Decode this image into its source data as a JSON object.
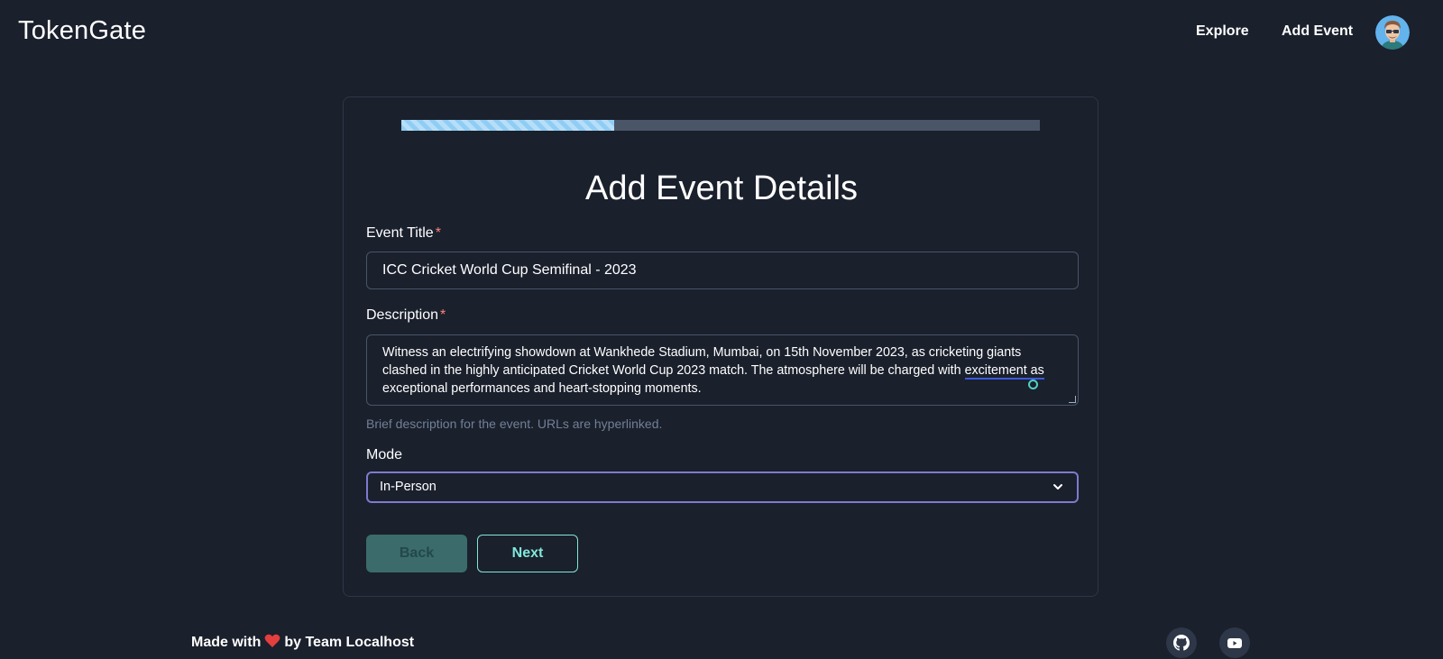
{
  "nav": {
    "brand": "TokenGate",
    "explore": "Explore",
    "add_event": "Add Event"
  },
  "form": {
    "progress_fraction": 0.333,
    "title": "Add Event Details",
    "event_title": {
      "label": "Event Title",
      "required_mark": "*",
      "value": "ICC Cricket World Cup Semifinal - 2023"
    },
    "description": {
      "label": "Description",
      "required_mark": "*",
      "value_before": "Witness an electrifying showdown at Wankhede Stadium, Mumbai, on 15th November 2023, as cricketing giants clashed in the highly anticipated Cricket World Cup 2023 match. The atmosphere will be charged with ",
      "value_underlined": "excitement as",
      "value_after": " exceptional performances and heart-stopping moments.",
      "helper": "Brief description for the event. URLs are hyperlinked."
    },
    "mode": {
      "label": "Mode",
      "selected": "In-Person"
    },
    "back_label": "Back",
    "next_label": "Next"
  },
  "footer": {
    "made_with": "Made with",
    "by": "by Team Localhost"
  },
  "colors": {
    "background": "#1a202c",
    "accent_teal": "#81e6d9",
    "progress_blue": "#90cdf4",
    "required_red": "#fc8181",
    "select_focus": "#7f7acf"
  }
}
